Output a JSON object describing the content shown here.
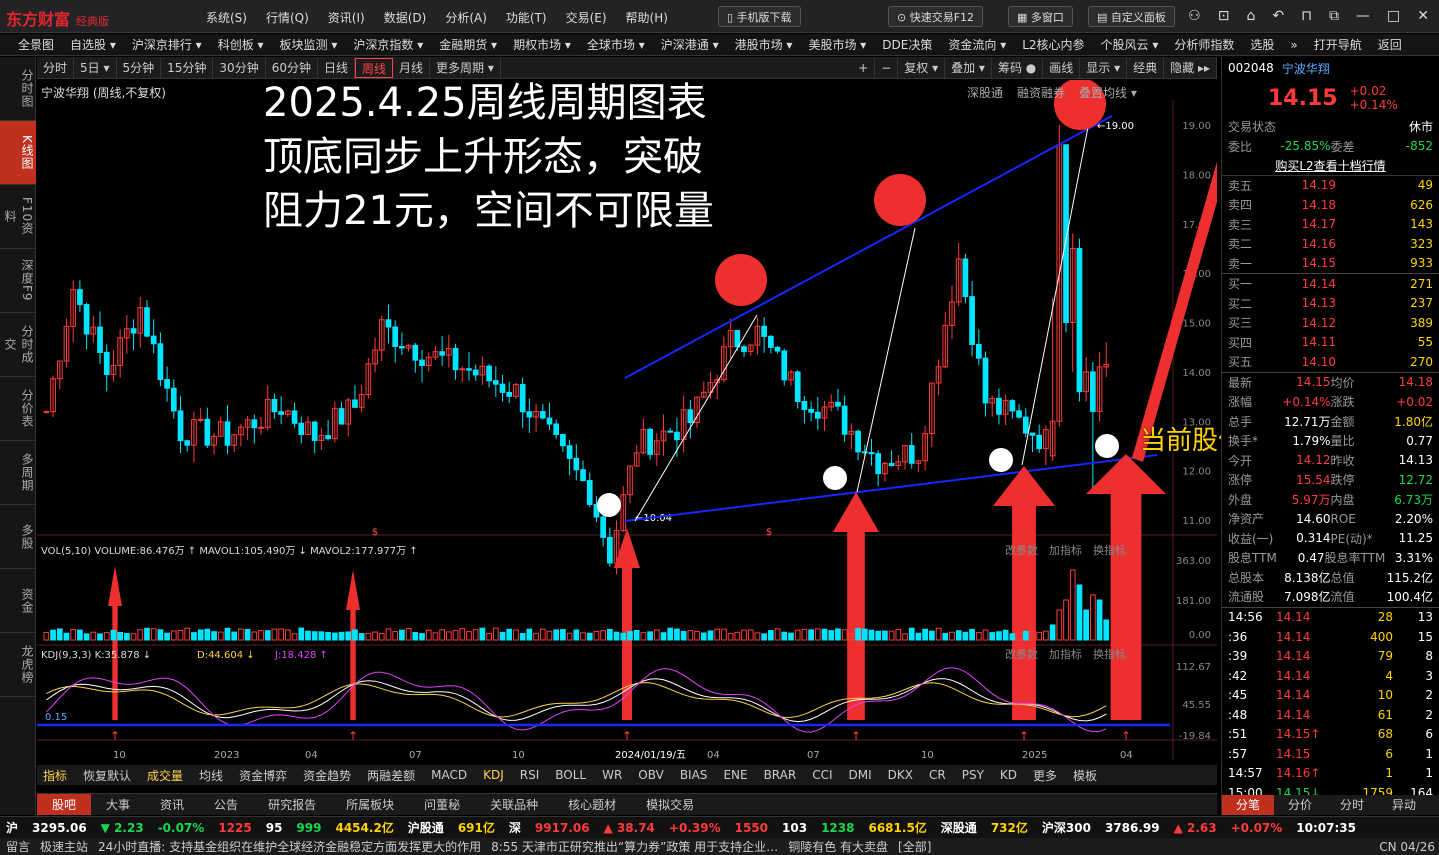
{
  "app": {
    "logo": "东方财富",
    "edition": "经典版"
  },
  "sysmenu": [
    "系统(S)",
    "行情(Q)",
    "资讯(I)",
    "数据(D)",
    "分析(A)",
    "功能(T)",
    "交易(E)",
    "帮助(H)"
  ],
  "toolbar": {
    "mobile": "手机版下载",
    "quicktrade": "快速交易F12",
    "multiwin": "多窗口",
    "custom": "自定义面板"
  },
  "nav": [
    "全景图",
    "自选股 ▾",
    "沪深京排行 ▾",
    "科创板 ▾",
    "板块监测 ▾",
    "沪深京指数 ▾",
    "金融期货 ▾",
    "期权市场 ▾",
    "全球市场 ▾",
    "沪深港通 ▾",
    "港股市场 ▾",
    "美股市场 ▾",
    "DDE决策",
    "资金流向 ▾",
    "L2核心内参",
    "个股风云 ▾",
    "分析师指数",
    "选股",
    "»",
    "打开导航",
    "返回"
  ],
  "lefttabs": [
    "分时图",
    "K线图",
    "F10资料",
    "深度F9",
    "分时成交",
    "分价表",
    "多周期",
    "多股",
    "资金",
    "龙虎榜"
  ],
  "periods": [
    "分时",
    "5日 ▾",
    "5分钟",
    "15分钟",
    "30分钟",
    "60分钟",
    "日线",
    "周线",
    "月线",
    "更多周期 ▾"
  ],
  "periods_right": [
    "+",
    "−",
    "复权 ▾",
    "叠加 ▾",
    "筹码 ●",
    "画线",
    "显示 ▾",
    "经典",
    "隐藏 ▸▸"
  ],
  "stock": {
    "code": "002048",
    "name": "宁波华翔",
    "chart_label": "宁波华翔 (周线,不复权)",
    "price": "14.15",
    "chg": "+0.02",
    "pct": "+0.14%"
  },
  "chart_header_right": [
    "深股通",
    "融资融券",
    "叠置均线 ▾"
  ],
  "price_labels": {
    "high": "19.00",
    "low": "10.04"
  },
  "yaxis": [
    "19.00",
    "18.00",
    "17.00",
    "16.00",
    "15.00",
    "14.00",
    "13.00",
    "12.00",
    "11.00"
  ],
  "xaxis": [
    "10",
    "2023",
    "04",
    "07",
    "10",
    "2024/01/19/五",
    "04",
    "07",
    "10",
    "2025",
    "04"
  ],
  "volume": {
    "legend": "VOL(5,10)  VOLUME:86.476万  ↑ MAVOL1:105.490万  ↓ MAVOL2:177.977万  ↑",
    "ticks": [
      "363.00",
      "181.00",
      "0.00"
    ],
    "right": [
      "改参数",
      "加指标",
      "换指标"
    ]
  },
  "kdj": {
    "legend_k": "KDJ(9,3,3)  K:35.878 ↓",
    "legend_d": "D:44.604 ↓",
    "legend_j": "J:18.428 ↑",
    "ticks": [
      "112.67",
      "45.55",
      "-19.84"
    ],
    "left_val": "0.15"
  },
  "annotation": {
    "title_lines": [
      "2025.4.25周线周期图表",
      "顶底同步上升形态，突破",
      "阻力21元，空间不可限量"
    ],
    "right_note": "当前股价刚刚脱离底部"
  },
  "indicators": [
    "指标",
    "恢复默认",
    "成交量",
    "均线",
    "资金博弈",
    "资金趋势",
    "两融差额",
    "MACD",
    "KDJ",
    "RSI",
    "BOLL",
    "WR",
    "OBV",
    "BIAS",
    "ENE",
    "BRAR",
    "CCI",
    "DMI",
    "DKX",
    "CR",
    "PSY",
    "KD",
    "更多",
    "模板"
  ],
  "bottomtabs": [
    "股吧",
    "大事",
    "资讯",
    "公告",
    "研究报告",
    "所属板块",
    "问董秘",
    "关联品种",
    "核心题材",
    "模拟交易"
  ],
  "right": {
    "status": [
      "交易状态",
      "休市"
    ],
    "weibi": [
      "委比",
      "-25.85%",
      "委差",
      "-852"
    ],
    "l2link": "购买L2查看十档行情",
    "sell": [
      [
        "卖五",
        "14.19",
        "49"
      ],
      [
        "卖四",
        "14.18",
        "626"
      ],
      [
        "卖三",
        "14.17",
        "143"
      ],
      [
        "卖二",
        "14.16",
        "323"
      ],
      [
        "卖一",
        "14.15",
        "933"
      ]
    ],
    "buy": [
      [
        "买一",
        "14.14",
        "271"
      ],
      [
        "买二",
        "14.13",
        "237"
      ],
      [
        "买三",
        "14.12",
        "389"
      ],
      [
        "买四",
        "14.11",
        "55"
      ],
      [
        "买五",
        "14.10",
        "270"
      ]
    ],
    "stats": [
      [
        "最新",
        "14.15",
        "均价",
        "14.18"
      ],
      [
        "涨幅",
        "+0.14%",
        "涨跌",
        "+0.02"
      ],
      [
        "总手",
        "12.71万",
        "金额",
        "1.80亿"
      ],
      [
        "换手*",
        "1.79%",
        "量比",
        "0.77"
      ],
      [
        "今开",
        "14.12",
        "昨收",
        "14.13"
      ],
      [
        "涨停",
        "15.54",
        "跌停",
        "12.72"
      ],
      [
        "外盘",
        "5.97万",
        "内盘",
        "6.73万"
      ],
      [
        "净资产",
        "14.60",
        "ROE",
        "2.20%"
      ],
      [
        "收益(一)",
        "0.314",
        "PE(动)*",
        "11.25"
      ],
      [
        "股息TTM",
        "0.47",
        "股息率TTM",
        "3.31%"
      ],
      [
        "总股本",
        "8.138亿",
        "总值",
        "115.2亿"
      ],
      [
        "流通股",
        "7.098亿",
        "流值",
        "100.4亿"
      ]
    ],
    "ticks": [
      [
        "14:56",
        "14.14",
        "28",
        "13"
      ],
      [
        ":36",
        "14.14",
        "400",
        "15"
      ],
      [
        ":39",
        "14.14",
        "79",
        "8"
      ],
      [
        ":42",
        "14.14",
        "4",
        "3"
      ],
      [
        ":45",
        "14.14",
        "10",
        "2"
      ],
      [
        ":48",
        "14.14",
        "61",
        "2"
      ],
      [
        ":51",
        "14.15↑",
        "68",
        "6"
      ],
      [
        ":57",
        "14.15",
        "6",
        "1"
      ],
      [
        "14:57",
        "14.16↑",
        "1",
        "1"
      ],
      [
        "15:00",
        "14.15↓",
        "1759",
        "164"
      ]
    ],
    "tabs": [
      "分笔",
      "分价",
      "分时",
      "异动"
    ]
  },
  "statusbar": {
    "sh": "沪",
    "sh_idx": "3295.06",
    "sh_chg": "▼ 2.23",
    "sh_pct": "-0.07%",
    "sh_up": "1225",
    "sh_flat": "95",
    "sh_dn": "999",
    "sh_amt": "4454.2亿",
    "hgt": "沪股通",
    "hgt_v": "691亿",
    "sz": "深",
    "sz_idx": "9917.06",
    "sz_chg": "▲ 38.74",
    "sz_pct": "+0.39%",
    "sz_up": "1550",
    "sz_flat": "103",
    "sz_dn": "1238",
    "sz_amt": "6681.5亿",
    "sgt": "深股通",
    "sgt_v": "732亿",
    "hs300": "沪深300",
    "hs300_v": "3786.99",
    "hs_chg": "▲ 2.63",
    "hs_pct": "+0.07%",
    "time": "10:07:35"
  },
  "ticker": {
    "items": [
      "留言",
      "极速主站",
      "24小时直播: 支持基金组织在维护全球经济金融稳定方面发挥更大的作用",
      "8:55 天津市正研究推出“算力券”政策 用于支持企业…",
      "铜陵有色 有大卖盘",
      "[全部]"
    ],
    "date": "CN 04/26"
  },
  "colors": {
    "up": "#ff3b3b",
    "down": "#00e5ff",
    "trendline": "#0a1ff0",
    "bg": "#000000"
  }
}
